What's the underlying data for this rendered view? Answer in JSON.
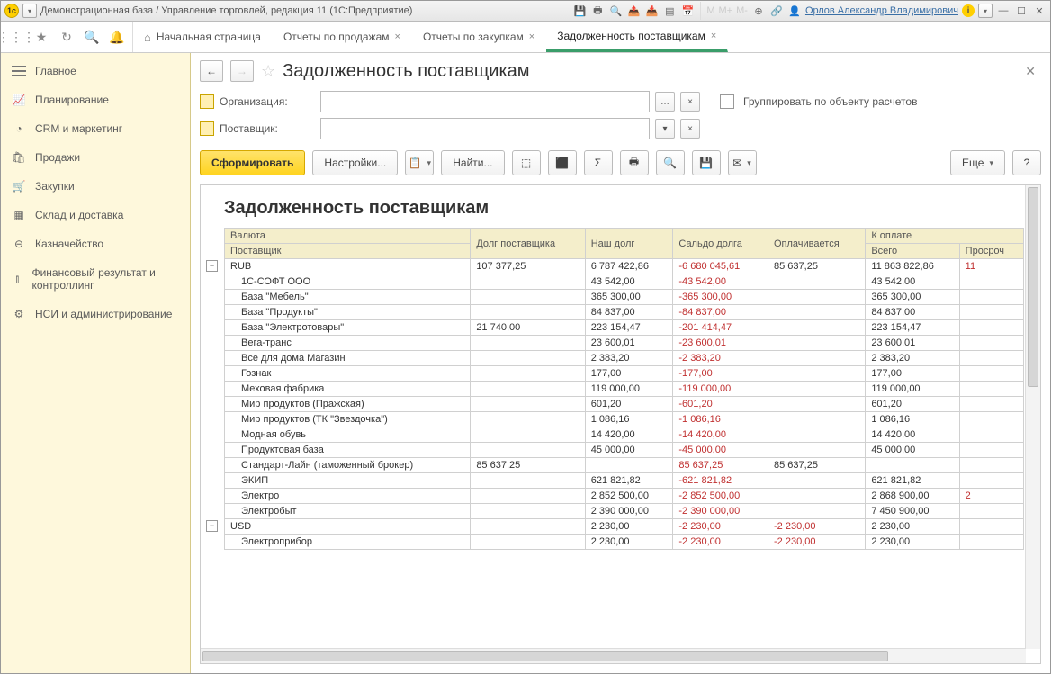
{
  "title_app": "Демонстрационная база / Управление торговлей, редакция 11  (1С:Предприятие)",
  "user_name": "Орлов Александр Владимирович",
  "m_labels": {
    "m": "M",
    "mp": "M+",
    "mm": "M-"
  },
  "tabs": [
    {
      "label": "Начальная страница",
      "closable": false,
      "home": true
    },
    {
      "label": "Отчеты по продажам",
      "closable": true
    },
    {
      "label": "Отчеты по закупкам",
      "closable": true
    },
    {
      "label": "Задолженность поставщикам",
      "closable": true,
      "active": true
    }
  ],
  "sidebar": [
    {
      "label": "Главное",
      "icon": "burger"
    },
    {
      "label": "Планирование",
      "icon": "📈"
    },
    {
      "label": "CRM и маркетинг",
      "icon": "◔"
    },
    {
      "label": "Продажи",
      "icon": "🛍"
    },
    {
      "label": "Закупки",
      "icon": "🛒"
    },
    {
      "label": "Склад и доставка",
      "icon": "▦"
    },
    {
      "label": "Казначейство",
      "icon": "⊖"
    },
    {
      "label": "Финансовый результат и контроллинг",
      "icon": "⫾"
    },
    {
      "label": "НСИ и администрирование",
      "icon": "⚙"
    }
  ],
  "page_title": "Задолженность поставщикам",
  "filters": {
    "org_label": "Организация:",
    "supplier_label": "Поставщик:",
    "group_label": "Группировать по объекту расчетов"
  },
  "buttons": {
    "form": "Сформировать",
    "settings": "Настройки...",
    "find": "Найти...",
    "more": "Еще",
    "help": "?"
  },
  "report": {
    "title": "Задолженность поставщикам",
    "headers": {
      "currency": "Валюта",
      "supplier": "Поставщик",
      "supplier_debt": "Долг поставщика",
      "our_debt": "Наш долг",
      "balance": "Сальдо долга",
      "paying": "Оплачивается",
      "to_pay": "К оплате",
      "total": "Всего",
      "overdue": "Просроч"
    },
    "groups": [
      {
        "name": "RUB",
        "supplier_debt": "107 377,25",
        "our_debt": "6 787 422,86",
        "balance": "-6 680 045,61",
        "paying": "85 637,25",
        "total": "11 863 822,86",
        "overdue": "11",
        "rows": [
          {
            "name": "1С-СОФТ ООО",
            "our_debt": "43 542,00",
            "balance": "-43 542,00",
            "total": "43 542,00"
          },
          {
            "name": "База \"Мебель\"",
            "our_debt": "365 300,00",
            "balance": "-365 300,00",
            "total": "365 300,00"
          },
          {
            "name": "База \"Продукты\"",
            "our_debt": "84 837,00",
            "balance": "-84 837,00",
            "total": "84 837,00"
          },
          {
            "name": "База \"Электротовары\"",
            "supplier_debt": "21 740,00",
            "our_debt": "223 154,47",
            "balance": "-201 414,47",
            "total": "223 154,47"
          },
          {
            "name": "Вега-транс",
            "our_debt": "23 600,01",
            "balance": "-23 600,01",
            "total": "23 600,01"
          },
          {
            "name": "Все для дома Магазин",
            "our_debt": "2 383,20",
            "balance": "-2 383,20",
            "total": "2 383,20"
          },
          {
            "name": "Гознак",
            "our_debt": "177,00",
            "balance": "-177,00",
            "total": "177,00"
          },
          {
            "name": "Меховая фабрика",
            "our_debt": "119 000,00",
            "balance": "-119 000,00",
            "total": "119 000,00"
          },
          {
            "name": "Мир продуктов (Пражская)",
            "our_debt": "601,20",
            "balance": "-601,20",
            "total": "601,20"
          },
          {
            "name": "Мир продуктов (ТК \"Звездочка\")",
            "our_debt": "1 086,16",
            "balance": "-1 086,16",
            "total": "1 086,16"
          },
          {
            "name": "Модная обувь",
            "our_debt": "14 420,00",
            "balance": "-14 420,00",
            "total": "14 420,00"
          },
          {
            "name": "Продуктовая база",
            "our_debt": "45 000,00",
            "balance": "-45 000,00",
            "total": "45 000,00"
          },
          {
            "name": "Стандарт-Лайн (таможенный брокер)",
            "supplier_debt": "85 637,25",
            "balance": "85 637,25",
            "paying": "85 637,25"
          },
          {
            "name": "ЭКИП",
            "our_debt": "621 821,82",
            "balance": "-621 821,82",
            "total": "621 821,82"
          },
          {
            "name": "Электро",
            "our_debt": "2 852 500,00",
            "balance": "-2 852 500,00",
            "total": "2 868 900,00",
            "overdue": "2"
          },
          {
            "name": "Электробыт",
            "our_debt": "2 390 000,00",
            "balance": "-2 390 000,00",
            "total": "7 450 900,00"
          }
        ]
      },
      {
        "name": "USD",
        "our_debt": "2 230,00",
        "balance": "-2 230,00",
        "paying": "-2 230,00",
        "total": "2 230,00",
        "rows": [
          {
            "name": "Электроприбор",
            "our_debt": "2 230,00",
            "balance": "-2 230,00",
            "paying": "-2 230,00",
            "total": "2 230,00"
          }
        ]
      }
    ]
  }
}
